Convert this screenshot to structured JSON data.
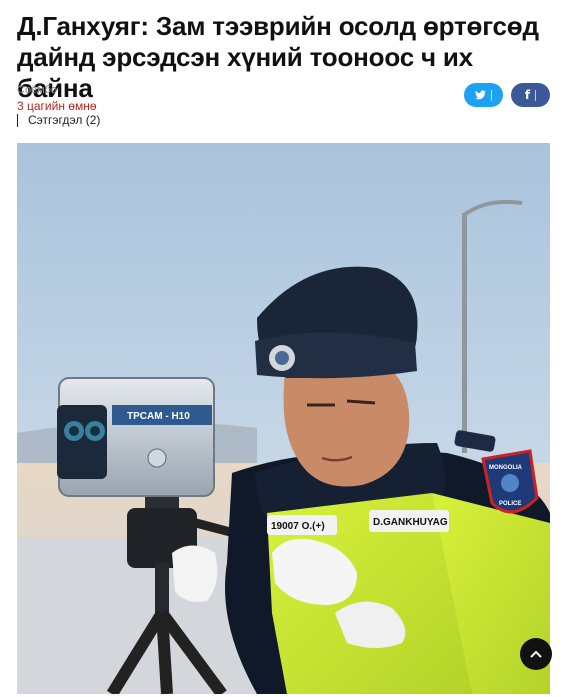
{
  "article": {
    "title": "Д.Ганхуяг: Зам тээврийн осолд өртөгсөд дайнд эрсэдсэн хүний тооноос ч их байна",
    "category": "Соёмбо",
    "time_ago": "3 цагийн өмнө",
    "comments_label": "Сэтгэгдэл (2)"
  },
  "share": {
    "twitter_icon": "twitter-icon",
    "facebook_icon": "facebook-icon",
    "twitter_color": "#1da1f2",
    "facebook_color": "#3b5998"
  },
  "photo": {
    "device_label": "TPCAM - H10",
    "badge_left": "19007 О.(+)",
    "badge_right": "D.GANKHUYAG",
    "patch_top": "MONGOLIA",
    "patch_bottom": "POLICE"
  },
  "controls": {
    "scroll_top_icon": "chevron-up-icon"
  }
}
